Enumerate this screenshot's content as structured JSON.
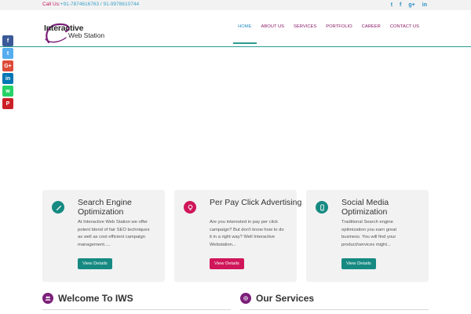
{
  "topbar": {
    "contact_label": "Call Us:",
    "contact_numbers": "+91-7874616763 / 91-9978610744",
    "social": [
      {
        "name": "twitter",
        "glyph": "t"
      },
      {
        "name": "facebook",
        "glyph": "f"
      },
      {
        "name": "google-plus",
        "glyph": "g+"
      },
      {
        "name": "linkedin",
        "glyph": "in"
      }
    ]
  },
  "logo": {
    "line1": "Interactive",
    "line2": "Web Station"
  },
  "nav": {
    "items": [
      "HOME",
      "ABOUT US",
      "SERVICES",
      "PORTFOLIO",
      "CAREER",
      "CONTACT US"
    ],
    "active": "HOME"
  },
  "share": [
    {
      "name": "facebook",
      "glyph": "f",
      "color": "#3b5998"
    },
    {
      "name": "twitter",
      "glyph": "t",
      "color": "#55acee"
    },
    {
      "name": "google-plus",
      "glyph": "G+",
      "color": "#dd4b39"
    },
    {
      "name": "linkedin",
      "glyph": "in",
      "color": "#0077b5"
    },
    {
      "name": "whatsapp",
      "glyph": "w",
      "color": "#25d366"
    },
    {
      "name": "pinterest",
      "glyph": "P",
      "color": "#cb2027"
    }
  ],
  "cards": [
    {
      "icon": "pen-icon",
      "icon_color": "#168a82",
      "title": "Search Engine Optimization",
      "description": "At Interactive Web Station we offer potent blend of fair SEO techniques as well as cost efficient campaign management.....",
      "button": "View Details",
      "button_color": "#168a82"
    },
    {
      "icon": "lightbulb-icon",
      "icon_color": "#d0165a",
      "title": "Per Pay Click Advertising",
      "description": "Are you interested in pay per click campaign? But don't know how to do it in a right way? Well Interactive Webstation...",
      "button": "View Details",
      "button_color": "#d0165a"
    },
    {
      "icon": "mobile-icon",
      "icon_color": "#168a82",
      "title": "Social Media Optimization",
      "description": "Traditional Search engine optimization you earn great business. You will find your product/services might...",
      "button": "View Details",
      "button_color": "#168a82"
    }
  ],
  "sections": {
    "welcome": "Welcome To IWS",
    "services": "Our Services"
  },
  "colors": {
    "accent": "#2a9d8f",
    "brand_purple": "#7b1f7a",
    "nav_text": "#8a1c6a",
    "nav_active": "#2c8fc4"
  }
}
